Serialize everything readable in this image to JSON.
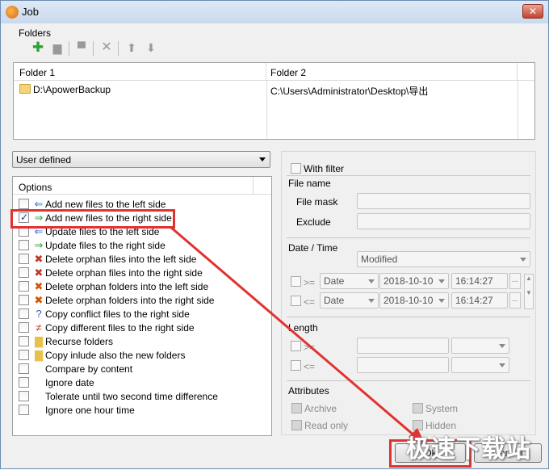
{
  "window": {
    "title": "Job",
    "close_glyph": "✕"
  },
  "folders": {
    "group_label": "Folders",
    "toolbar_icons": [
      "add-icon",
      "edit-icon",
      "print-icon",
      "delete-icon",
      "arrow-up-icon",
      "arrow-down-icon"
    ],
    "columns": [
      "Folder 1",
      "Folder 2"
    ],
    "rows": [
      {
        "folder1": "D:\\ApowerBackup",
        "folder2": "C:\\Users\\Administrator\\Desktop\\导出"
      }
    ]
  },
  "mode_select": {
    "value": "User defined"
  },
  "options": {
    "header": "Options",
    "items": [
      {
        "label": "Add new files to the left side",
        "checked": false,
        "icon": "add-left-icon"
      },
      {
        "label": "Add new files to the right side",
        "checked": true,
        "icon": "add-right-icon"
      },
      {
        "label": "Update files to the left side",
        "checked": false,
        "icon": "update-left-icon"
      },
      {
        "label": "Update files to the right side",
        "checked": false,
        "icon": "update-right-icon"
      },
      {
        "label": "Delete orphan files into the left side",
        "checked": false,
        "icon": "delete-left-icon"
      },
      {
        "label": "Delete orphan files into the right side",
        "checked": false,
        "icon": "delete-right-icon"
      },
      {
        "label": "Delete orphan folders into the left side",
        "checked": false,
        "icon": "delete-folder-left-icon"
      },
      {
        "label": "Delete orphan folders into the right side",
        "checked": false,
        "icon": "delete-folder-right-icon"
      },
      {
        "label": "Copy conflict files to the right side",
        "checked": false,
        "icon": "conflict-icon"
      },
      {
        "label": "Copy different files to the right side",
        "checked": false,
        "icon": "different-icon"
      },
      {
        "label": "Recurse folders",
        "checked": false,
        "icon": "folder-icon"
      },
      {
        "label": "Copy inlude also the new folders",
        "checked": false,
        "icon": "new-folder-icon"
      },
      {
        "label": "Compare by content",
        "checked": false,
        "icon": ""
      },
      {
        "label": "Ignore date",
        "checked": false,
        "icon": ""
      },
      {
        "label": "Tolerate until two second time difference",
        "checked": false,
        "icon": ""
      },
      {
        "label": "Ignore one hour time",
        "checked": false,
        "icon": ""
      }
    ]
  },
  "filter": {
    "with_filter": "With filter",
    "file_name": "File name",
    "file_mask": "File mask",
    "exclude": "Exclude",
    "date_time": "Date / Time",
    "date_kind": "Modified",
    "ge": ">=",
    "le": "<=",
    "date_label": "Date",
    "date_value": "2018-10-10",
    "time_value": "16:14:27",
    "ellipsis": "...",
    "length": "Length",
    "attributes": "Attributes",
    "archive": "Archive",
    "system": "System",
    "read_only": "Read only",
    "hidden": "Hidden"
  },
  "buttons": {
    "ok": "Ok",
    "cancel": "Cancel"
  },
  "watermark": "极速下载站",
  "colors": {
    "highlight": "#e0332f"
  }
}
